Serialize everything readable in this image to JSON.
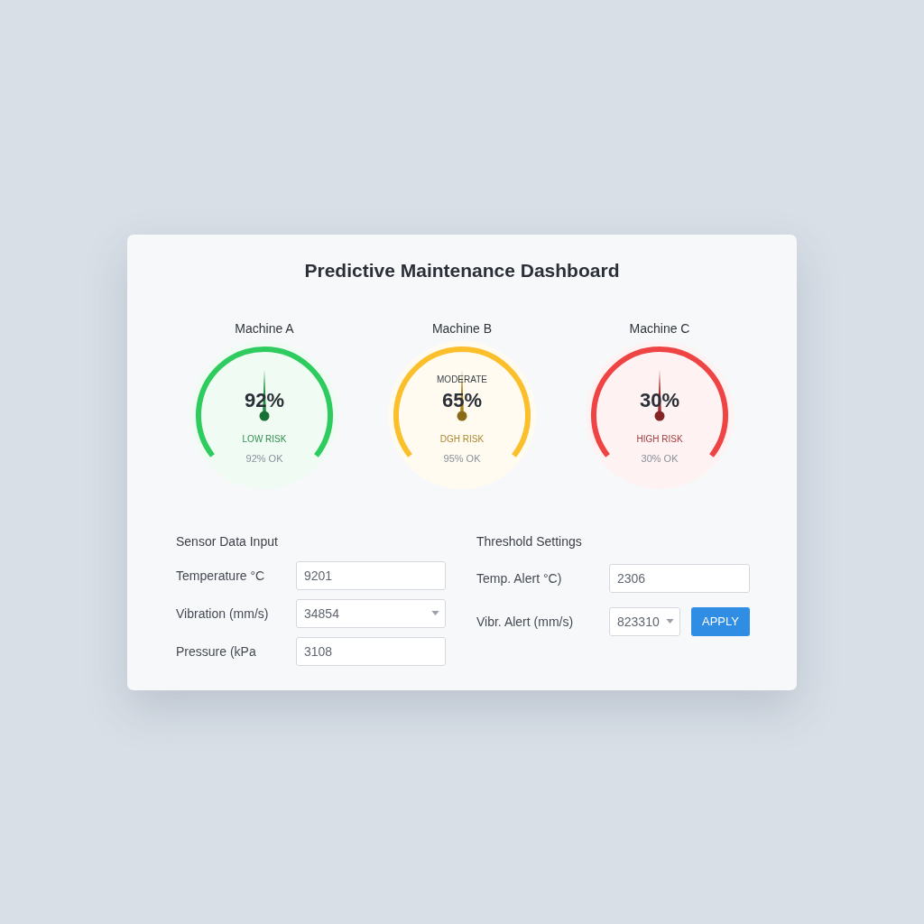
{
  "title": "Predictive Maintenance Dashboard",
  "machines": [
    {
      "name": "Machine A",
      "value": "92%",
      "color": "#2ecc5f",
      "risk": "LOW RISK",
      "status": "92% OK"
    },
    {
      "name": "Machine B",
      "value": "65%",
      "color": "#fbbf2b",
      "top_label": "MODERATE",
      "risk": "DGH RISK",
      "status": "95% OK"
    },
    {
      "name": "Machine C",
      "value": "30%",
      "color": "#ef4444",
      "risk": "HIGH RISK",
      "status": "30% OK"
    }
  ],
  "sensor_input": {
    "heading": "Sensor Data Input",
    "fields": [
      {
        "label": "Temperature °C",
        "value": "9201",
        "kind": "text"
      },
      {
        "label": "Vibration (mm/s)",
        "value": "34854",
        "kind": "select"
      },
      {
        "label": "Pressure (kPa",
        "value": "3108",
        "kind": "text"
      }
    ]
  },
  "thresholds": {
    "heading": "Threshold Settings",
    "fields": [
      {
        "label": "Temp. Alert °C)",
        "value": "2306",
        "kind": "text"
      },
      {
        "label": "Vibr. Alert (mm/s)",
        "value": "823310",
        "kind": "select"
      }
    ],
    "button": "APPLY"
  }
}
